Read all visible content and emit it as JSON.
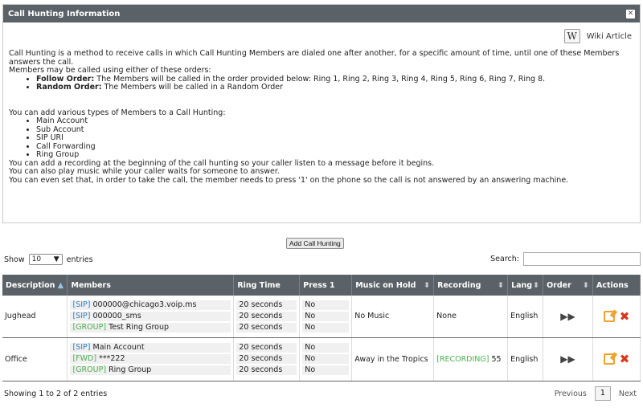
{
  "panel": {
    "title": "Call Hunting Information",
    "close": "✕",
    "wiki_label": "Wiki Article",
    "wiki_glyph": "W",
    "intro": "Call Hunting is a method to receive calls in which Call Hunting Members are dialed one after another, for a specific amount of time, until one of these Members answers the call.",
    "orders_intro": "Members may be called using either of these orders:",
    "orders": [
      {
        "name": "Follow Order:",
        "desc": "The Members will be called in the order provided below: Ring 1, Ring 2, Ring 3, Ring 4, Ring 5, Ring 6, Ring 7, Ring 8."
      },
      {
        "name": "Random Order:",
        "desc": "The Members will be called in a Random Order"
      }
    ],
    "types_intro": "You can add various types of Members to a Call Hunting:",
    "types": [
      "Main Account",
      "Sub Account",
      "SIP URI",
      "Call Forwarding",
      "Ring Group"
    ],
    "notes": [
      "You can add a recording at the beginning of the call hunting so your caller listen to a message before it begins.",
      "You can also play music while your caller waits for someone to answer.",
      "You can even set that, in order to take the call, the member needs to press '1' on the phone so the call is not answered by an answering machine."
    ]
  },
  "toolbar": {
    "add_label": "Add Call Hunting",
    "show_label": "Show",
    "show_value": "10",
    "entries_label": "entries",
    "search_label": "Search:"
  },
  "table": {
    "headers": [
      "Description",
      "Members",
      "Ring Time",
      "Press 1",
      "Music on Hold",
      "Recording",
      "Lang",
      "Order",
      "Actions"
    ],
    "rows": [
      {
        "description": "Jughead",
        "members": [
          {
            "tag": "[SIP]",
            "text": "000000@chicago3.voip.ms",
            "tag_color": "#3a7db8"
          },
          {
            "tag": "[SIP]",
            "text": "000000_sms",
            "tag_color": "#3a7db8"
          },
          {
            "tag": "[GROUP]",
            "text": "Test Ring Group",
            "tag_color": "#4caf50"
          }
        ],
        "ring_times": [
          "20 seconds",
          "20 seconds",
          "20 seconds"
        ],
        "press1": [
          "No",
          "No",
          "No"
        ],
        "music": "No Music",
        "recording_tag": "",
        "recording": "None",
        "lang": "English",
        "order": "▶▶"
      },
      {
        "description": "Office",
        "members": [
          {
            "tag": "[SIP]",
            "text": "Main Account",
            "tag_color": "#3a7db8"
          },
          {
            "tag": "[FWD]",
            "text": "***222",
            "tag_color": "#4caf50"
          },
          {
            "tag": "[GROUP]",
            "text": "Ring Group",
            "tag_color": "#4caf50"
          }
        ],
        "ring_times": [
          "20 seconds",
          "20 seconds",
          "20 seconds"
        ],
        "press1": [
          "No",
          "No",
          "No"
        ],
        "music": "Away in the Tropics",
        "recording_tag": "[RECORDING]",
        "recording": "55",
        "lang": "English",
        "order": "▶▶"
      }
    ]
  },
  "footer": {
    "info": "Showing 1 to 2 of 2 entries",
    "previous": "Previous",
    "page": "1",
    "next": "Next"
  }
}
